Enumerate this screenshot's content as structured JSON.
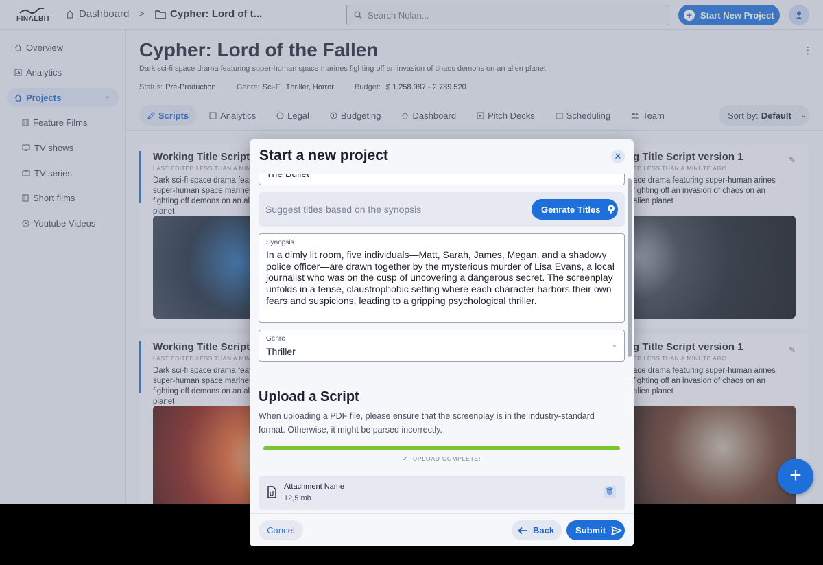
{
  "app": {
    "logo_text": "FINALBIT",
    "breadcrumb": {
      "home": "Dashboard",
      "separator": ">",
      "project": "Cypher: Lord of t..."
    },
    "search": {
      "placeholder": "Search Nolan..."
    },
    "start_new_project": "Start New Project"
  },
  "sidebar": {
    "items": [
      {
        "label": "Overview",
        "icon": "home-icon"
      },
      {
        "label": "Analytics",
        "icon": "analytics-icon"
      },
      {
        "label": "Projects",
        "icon": "home-icon",
        "active": true
      },
      {
        "label": "Feature Films",
        "icon": "film-icon"
      },
      {
        "label": "TV shows",
        "icon": "tv-icon"
      },
      {
        "label": "TV series",
        "icon": "tv-series-icon"
      },
      {
        "label": "Short films",
        "icon": "short-film-icon"
      },
      {
        "label": "Youtube Videos",
        "icon": "play-icon"
      }
    ]
  },
  "project": {
    "title": "Cypher: Lord of the Fallen",
    "description": "Dark sci-fi space drama featuring super-human space marines fighting off an invasion of chaos demons on an alien planet",
    "status_label": "Status:",
    "status_value": "Pre-Production",
    "genre_label": "Genre:",
    "genre_value": "Sci-Fi, Thriller, Horror",
    "budget_label": "Budget:",
    "budget_value": "$ 1.258.987 - 2.789.520"
  },
  "tabs": [
    {
      "label": "Scripts",
      "active": true
    },
    {
      "label": "Analytics"
    },
    {
      "label": "Legal"
    },
    {
      "label": "Budgeting"
    },
    {
      "label": "Dashboard"
    },
    {
      "label": "Pitch Decks"
    },
    {
      "label": "Scheduling"
    },
    {
      "label": "Team"
    }
  ],
  "sort": {
    "label": "Sort by:",
    "value": "Default"
  },
  "cards": {
    "c1": {
      "title": "Working Title Script v",
      "edited": "LAST EDITED LESS THAN A MINUT",
      "desc": "Dark sci-fi space drama featuring super-human space marines fighting off demons on an alien planet"
    },
    "c2": {
      "title": "g Title Script version 1",
      "edited": "ED LESS THAN A MINUTE AGO",
      "desc": "ace drama featuring super-human arines fighting off an invasion of chaos on an alien planet"
    },
    "c3": {
      "title": "Working Title Script v",
      "edited": "LAST EDITED LESS THAN A MINUT",
      "desc": "Dark sci-fi space drama featuring super-human space marines fighting off demons on an alien planet"
    },
    "c4": {
      "title": "g Title Script version 1",
      "edited": "ED LESS THAN A MINUTE AGO",
      "desc": "ace drama featuring super-human arines fighting off an invasion of chaos on an alien planet"
    }
  },
  "modal": {
    "title": "Start a new project",
    "previous_field_value": "The Bullet",
    "suggest_placeholder": "Suggest titles based on the synopsis",
    "generate_button": "Genrate Titles",
    "synopsis_label": "Synopsis",
    "synopsis_text": "In a dimly lit room, five individuals—Matt, Sarah, James, Megan, and a shadowy police officer—are drawn together by the mysterious murder of Lisa Evans, a local journalist who was on the cusp of uncovering a dangerous secret. The screenplay unfolds in a tense, claustrophobic setting where each character harbors their own fears and suspicions, leading to a gripping psychological thriller.",
    "genre_label": "Genre",
    "genre_value": "Thriller",
    "upload_title": "Upload a Script",
    "upload_desc": "When uploading a PDF file, please ensure that the screenplay is in the industry-standard format. Otherwise, it might be parsed incorrectly.",
    "upload_progress": 1.0,
    "upload_status": "UPLOAD COMPLETE!",
    "attachment_name": "Attachment Name",
    "attachment_size": "12,5 mb",
    "cancel": "Cancel",
    "back": "Back",
    "submit": "Submit"
  },
  "colors": {
    "accent": "#1e6fd9",
    "progress": "#7cc52d",
    "background": "#eef0f6"
  }
}
